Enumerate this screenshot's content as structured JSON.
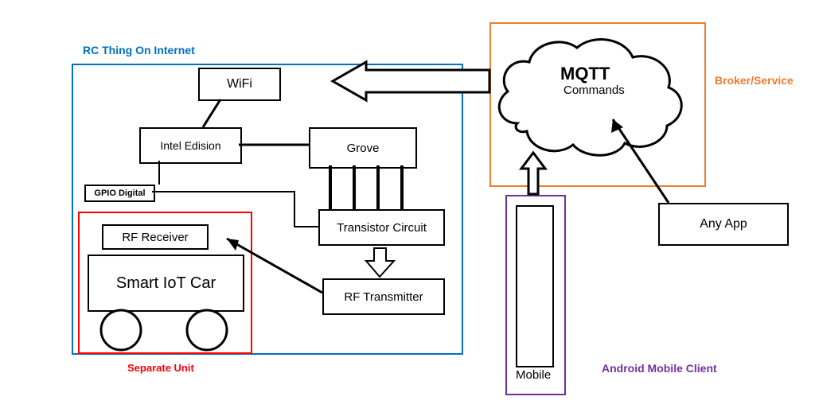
{
  "titles": {
    "rc_thing": "RC Thing  On Internet",
    "separate_unit": "Separate Unit",
    "broker_service": "Broker/Service",
    "android_client": "Android Mobile  Client"
  },
  "blocks": {
    "wifi": "WiFi",
    "intel_edison": "Intel Edision",
    "grove": "Grove",
    "gpio_digital": "GPIO Digital",
    "rf_receiver": "RF Receiver",
    "smart_iot_car": "Smart IoT Car",
    "transistor_circuit": "Transistor Circuit",
    "rf_transmitter": "RF Transmitter",
    "mqtt_heading": "MQTT",
    "mqtt_sub": "Commands",
    "any_app": "Any App",
    "mobile": "Mobile"
  },
  "colors": {
    "blue": "#0070c0",
    "red": "#ff0000",
    "orange": "#ed7d31",
    "purple": "#7030a0"
  }
}
